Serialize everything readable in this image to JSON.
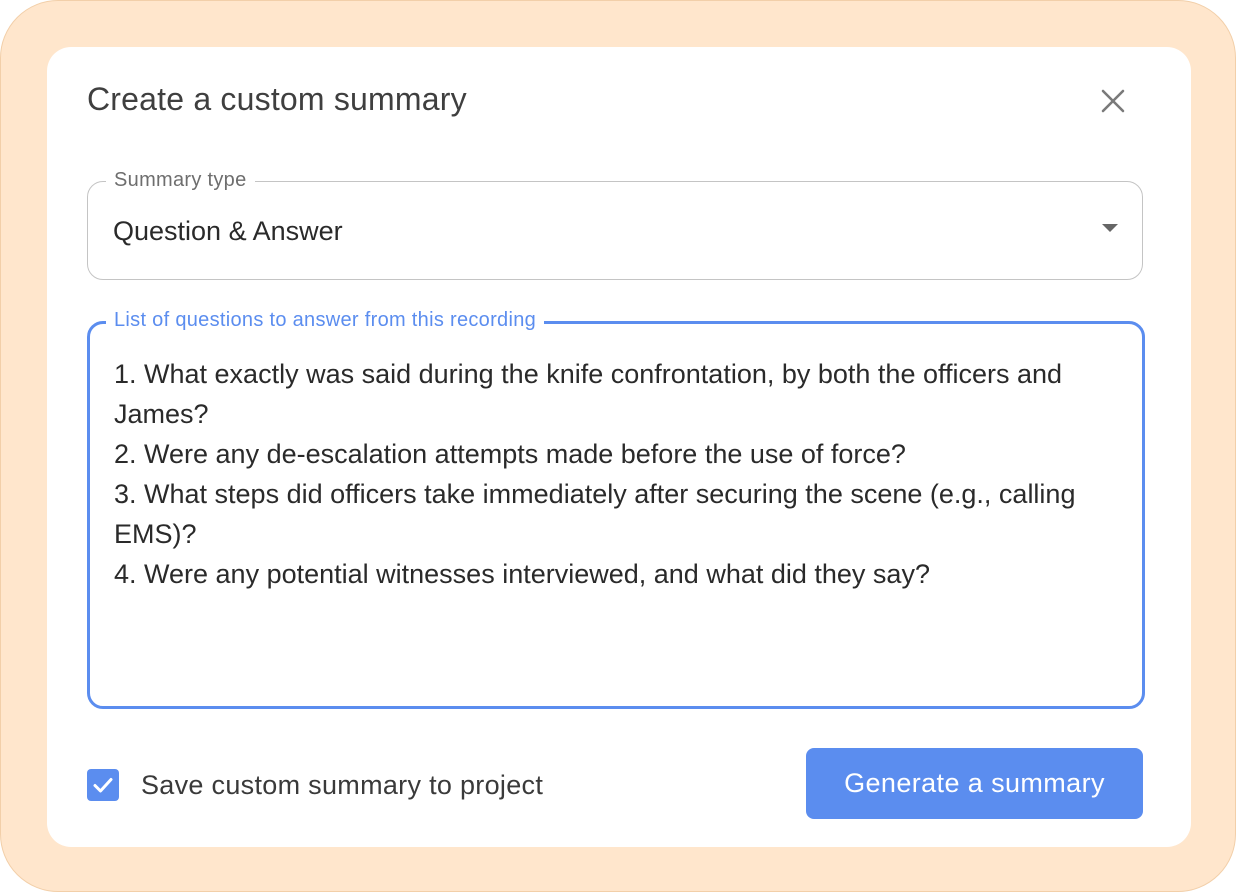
{
  "dialog": {
    "title": "Create a custom summary",
    "close_icon": "close-icon"
  },
  "summary_type": {
    "label": "Summary type",
    "value": "Question & Answer",
    "icon": "dropdown-arrow-icon"
  },
  "questions": {
    "label": "List of questions to answer from this recording",
    "value": "1. What exactly was said during the knife confrontation, by both the officers and James?\n2. Were any de-escalation attempts made before the use of force?\n3. What steps did officers take immediately after securing the scene (e.g., calling EMS)?\n4. Were any potential witnesses interviewed, and what did they say?"
  },
  "save_option": {
    "label": "Save custom summary to project",
    "checked": true,
    "icon": "checkmark-icon"
  },
  "actions": {
    "generate_label": "Generate a summary"
  },
  "colors": {
    "accent": "#5b8def",
    "frame": "#ffe6cc",
    "dialog_bg": "#ffffff",
    "title_text": "#3f3f3f"
  }
}
